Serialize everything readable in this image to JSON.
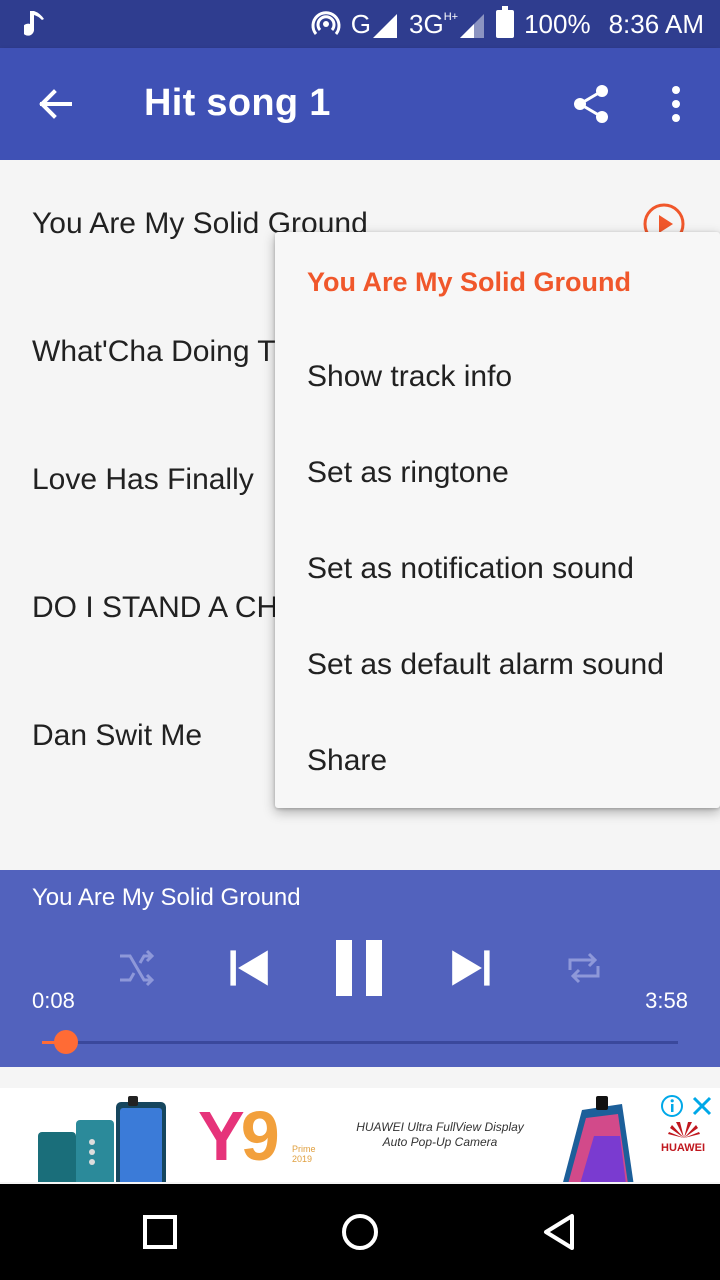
{
  "status_bar": {
    "network_label": "G",
    "network_label_2": "3G",
    "network_sup": "H+",
    "battery": "100%",
    "time": "8:36 AM",
    "icons": [
      "music-note-icon",
      "hotspot-icon",
      "signal-icon",
      "signal-icon",
      "battery-icon"
    ]
  },
  "app_bar": {
    "title": "Hit song 1",
    "icons": [
      "back-arrow-icon",
      "share-icon",
      "more-vert-icon"
    ],
    "color": "#3f51b5"
  },
  "songs": [
    {
      "title": "You Are My Solid Ground"
    },
    {
      "title": "What'Cha Doing T"
    },
    {
      "title": "Love Has Finally"
    },
    {
      "title": "DO I STAND A CH"
    },
    {
      "title": "Dan Swit Me"
    }
  ],
  "popup_menu": {
    "header": "You Are My Solid Ground",
    "items": [
      "Show track info",
      "Set as ringtone",
      "Set as notification sound",
      "Set as default alarm sound",
      "Share"
    ],
    "accent": "#f0572b"
  },
  "player": {
    "now_playing": "You Are My Solid Ground",
    "elapsed": "0:08",
    "duration": "3:58",
    "progress_fraction": 0.034,
    "controls": [
      "shuffle-icon",
      "previous-icon",
      "pause-icon",
      "next-icon",
      "repeat-icon"
    ],
    "color": "#5262bd",
    "accent": "#ff6b35"
  },
  "ad": {
    "product": "Y9",
    "tagline_line1": "HUAWEI Ultra FullView Display",
    "tagline_line2": "Auto Pop-Up Camera",
    "prime_line1": "Prime",
    "prime_line2": "2019",
    "brand": "HUAWEI"
  },
  "nav_bar": {
    "icons": [
      "recents-square-icon",
      "home-circle-icon",
      "back-triangle-icon"
    ]
  }
}
